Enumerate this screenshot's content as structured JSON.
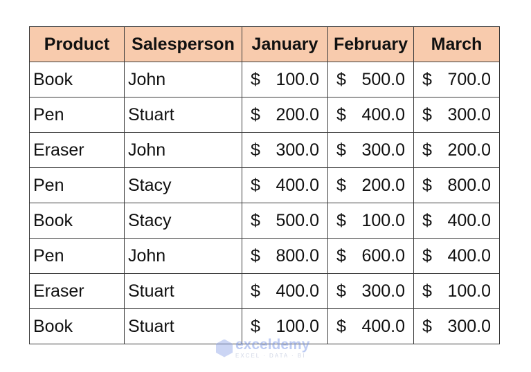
{
  "table": {
    "headers": [
      "Product",
      "Salesperson",
      "January",
      "February",
      "March"
    ],
    "currency_symbol": "$",
    "rows": [
      {
        "product": "Book",
        "salesperson": "John",
        "january": "100.0",
        "february": "500.0",
        "march": "700.0"
      },
      {
        "product": "Pen",
        "salesperson": "Stuart",
        "january": "200.0",
        "february": "400.0",
        "march": "300.0"
      },
      {
        "product": "Eraser",
        "salesperson": "John",
        "january": "300.0",
        "february": "300.0",
        "march": "200.0"
      },
      {
        "product": "Pen",
        "salesperson": "Stacy",
        "january": "400.0",
        "february": "200.0",
        "march": "800.0"
      },
      {
        "product": "Book",
        "salesperson": "Stacy",
        "january": "500.0",
        "february": "100.0",
        "march": "400.0"
      },
      {
        "product": "Pen",
        "salesperson": "John",
        "january": "800.0",
        "february": "600.0",
        "march": "400.0"
      },
      {
        "product": "Eraser",
        "salesperson": "Stuart",
        "january": "400.0",
        "february": "300.0",
        "march": "100.0"
      },
      {
        "product": "Book",
        "salesperson": "Stuart",
        "january": "100.0",
        "february": "400.0",
        "march": "300.0"
      }
    ]
  },
  "colors": {
    "header_background": "#f8cbad",
    "border": "#3a3a3a"
  },
  "watermark": {
    "name": "exceldemy",
    "tagline": "EXCEL · DATA · BI"
  }
}
